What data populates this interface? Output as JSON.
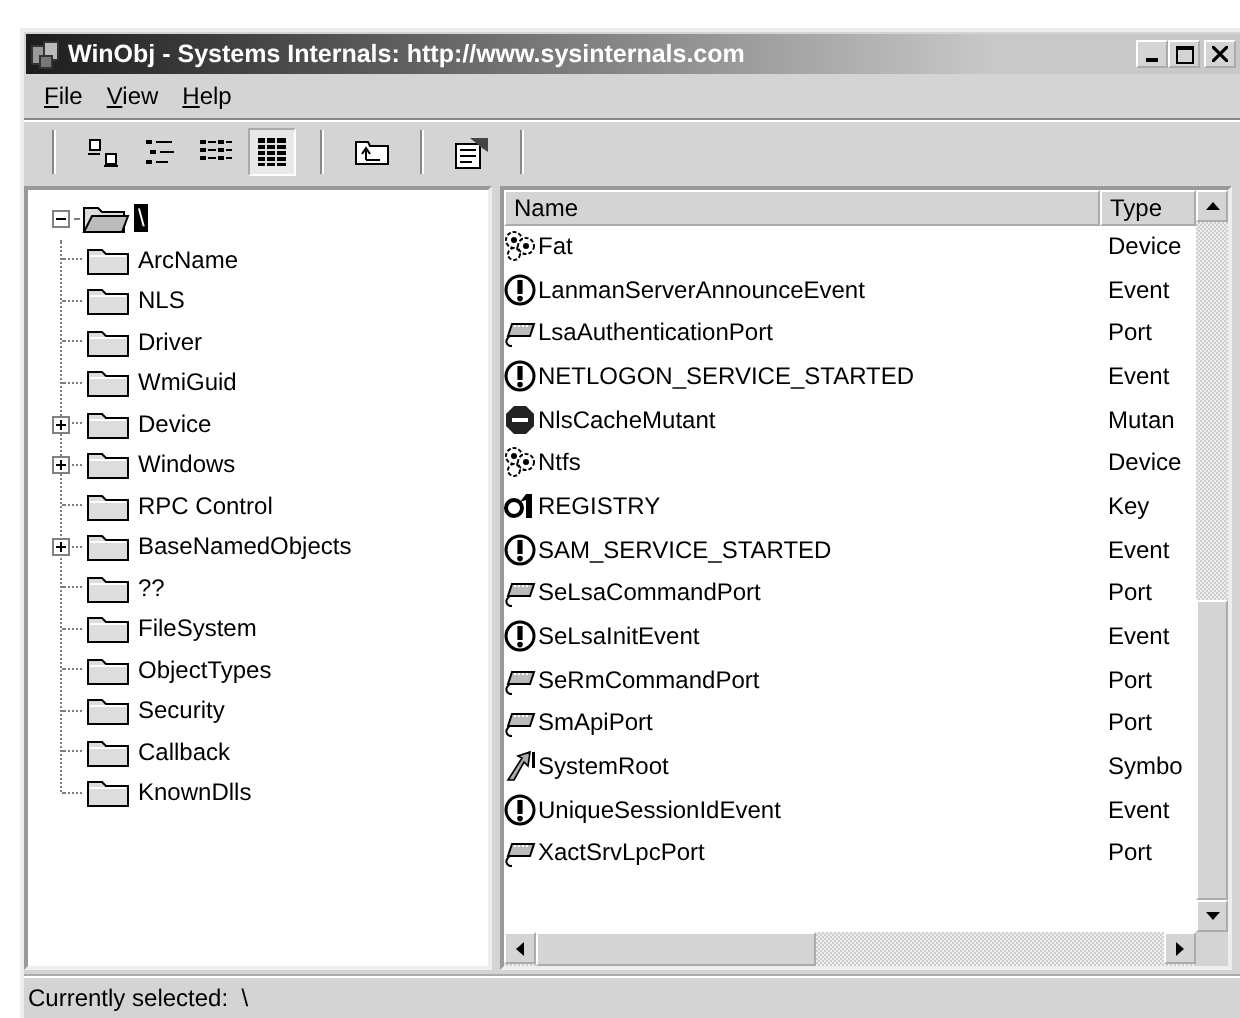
{
  "window": {
    "title": "WinObj - Systems Internals: http://www.sysinternals.com"
  },
  "menu": [
    "File",
    "View",
    "Help"
  ],
  "toolbar": {
    "groups": [
      [
        {
          "kind": "large-icons",
          "selected": false
        },
        {
          "kind": "small-icons",
          "selected": false
        },
        {
          "kind": "list",
          "selected": false
        },
        {
          "kind": "details",
          "selected": true
        }
      ],
      [
        {
          "kind": "up-folder",
          "selected": false
        }
      ],
      [
        {
          "kind": "properties",
          "selected": false
        }
      ]
    ]
  },
  "tree": {
    "root": {
      "label": "\\",
      "selected": true,
      "expanded": true,
      "children": [
        {
          "label": "ArcName",
          "kind": "leaf"
        },
        {
          "label": "NLS",
          "kind": "leaf"
        },
        {
          "label": "Driver",
          "kind": "leaf"
        },
        {
          "label": "WmiGuid",
          "kind": "leaf"
        },
        {
          "label": "Device",
          "kind": "collapsed"
        },
        {
          "label": "Windows",
          "kind": "collapsed"
        },
        {
          "label": "RPC Control",
          "kind": "leaf"
        },
        {
          "label": "BaseNamedObjects",
          "kind": "collapsed"
        },
        {
          "label": "??",
          "kind": "leaf"
        },
        {
          "label": "FileSystem",
          "kind": "leaf"
        },
        {
          "label": "ObjectTypes",
          "kind": "leaf"
        },
        {
          "label": "Security",
          "kind": "leaf"
        },
        {
          "label": "Callback",
          "kind": "leaf"
        },
        {
          "label": "KnownDlls",
          "kind": "leaf"
        }
      ]
    }
  },
  "table": {
    "columns": [
      "Name",
      "Type"
    ],
    "rows": [
      {
        "name": "Fat",
        "type": "Device",
        "kind": "device"
      },
      {
        "name": "LanmanServerAnnounceEvent",
        "type": "Event",
        "kind": "event"
      },
      {
        "name": "LsaAuthenticationPort",
        "type": "Port",
        "kind": "port"
      },
      {
        "name": "NETLOGON_SERVICE_STARTED",
        "type": "Event",
        "kind": "event"
      },
      {
        "name": "NlsCacheMutant",
        "type": "Mutan",
        "kind": "mutant"
      },
      {
        "name": "Ntfs",
        "type": "Device",
        "kind": "device"
      },
      {
        "name": "REGISTRY",
        "type": "Key",
        "kind": "key"
      },
      {
        "name": "SAM_SERVICE_STARTED",
        "type": "Event",
        "kind": "event"
      },
      {
        "name": "SeLsaCommandPort",
        "type": "Port",
        "kind": "port"
      },
      {
        "name": "SeLsaInitEvent",
        "type": "Event",
        "kind": "event"
      },
      {
        "name": "SeRmCommandPort",
        "type": "Port",
        "kind": "port"
      },
      {
        "name": "SmApiPort",
        "type": "Port",
        "kind": "port"
      },
      {
        "name": "SystemRoot",
        "type": "Symbo",
        "kind": "symlink"
      },
      {
        "name": "UniqueSessionIdEvent",
        "type": "Event",
        "kind": "event"
      },
      {
        "name": "XactSrvLpcPort",
        "type": "Port",
        "kind": "port"
      }
    ]
  },
  "status_bar": "Currently selected:  \\"
}
